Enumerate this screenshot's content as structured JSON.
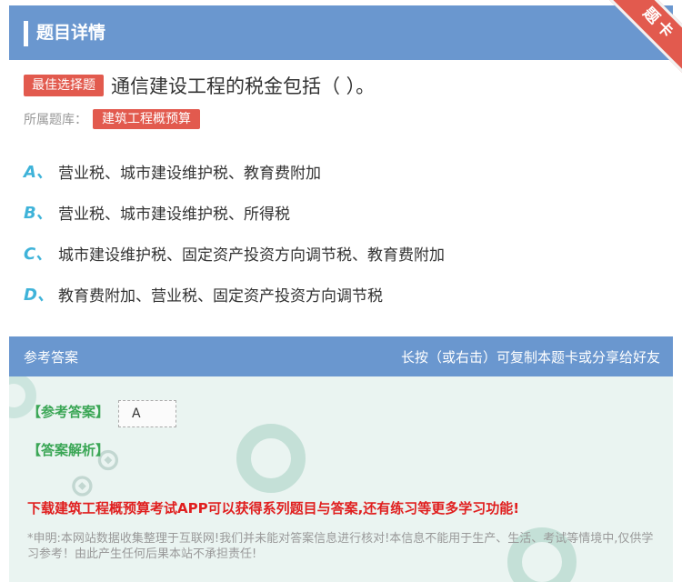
{
  "header": {
    "title": "题目详情",
    "corner_badge": "题卡"
  },
  "question": {
    "type_tag": "最佳选择题",
    "text": "通信建设工程的税金包括（ ）。",
    "library_label": "所属题库：",
    "library_tag": "建筑工程概预算"
  },
  "options": [
    {
      "letter": "A、",
      "text": "营业税、城市建设维护税、教育费附加"
    },
    {
      "letter": "B、",
      "text": "营业税、城市建设维护税、所得税"
    },
    {
      "letter": "C、",
      "text": "城市建设维护税、固定资产投资方向调节税、教育费附加"
    },
    {
      "letter": "D、",
      "text": "教育费附加、营业税、固定资产投资方向调节税"
    }
  ],
  "answer": {
    "panel_title": "参考答案",
    "panel_hint": "长按（或右击）可复制本题卡或分享给好友",
    "answer_label": "【参考答案】",
    "answer_value": "A",
    "analysis_label": "【答案解析】",
    "promo": "下载建筑工程概预算考试APP可以获得系列题目与答案,还有练习等更多学习功能!",
    "disclaimer": "*申明:本网站数据收集整理于互联网!我们并未能对答案信息进行核对!本信息不能用于生产、生活、考试等情境中,仅供学习参考！由此产生任何后果本站不承担责任!"
  },
  "colors": {
    "header_bg": "#6a97cf",
    "tag_red": "#e25a4e",
    "option_letter": "#3fb3d9",
    "answer_green": "#3aa655",
    "promo_red": "#e01f1f",
    "panel_bg": "#eaf4f1"
  }
}
